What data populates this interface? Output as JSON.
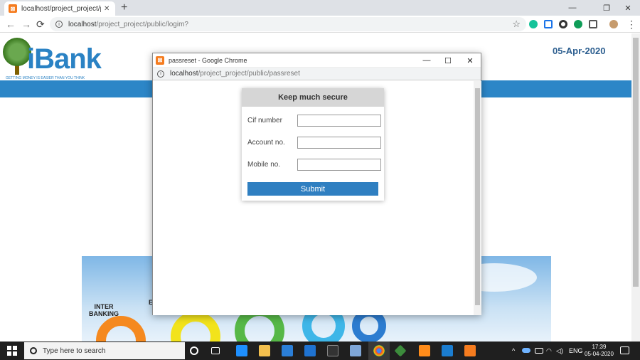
{
  "browser": {
    "tab_title": "localhost/project_project/public/",
    "tab_close": "✕",
    "new_tab": "+",
    "url_host": "localhost",
    "url_path": "/project_project/public/logim?",
    "window_controls": {
      "minimize": "—",
      "restore": "❐",
      "close": "✕"
    },
    "nav": {
      "back": "←",
      "forward": "→",
      "reload": "⟳"
    },
    "bookmark_icon": "☆",
    "menu_icon": "⋮"
  },
  "page": {
    "logo_text": "iBank",
    "logo_tagline": "GETTING MONEY IS EASIER THAN YOU THINK",
    "date": "05-Apr-2020",
    "banner_text_1": "INTER",
    "banner_text_2": "BANKING",
    "banner_text_3": "E"
  },
  "popup": {
    "window_title": "passreset - Google Chrome",
    "url_host": "localhost",
    "url_path": "/project_project/public/passreset",
    "controls": {
      "minimize": "—",
      "maximize": "☐",
      "close": "✕"
    },
    "form": {
      "title": "Keep much secure",
      "fields": [
        {
          "label": "Cif number",
          "value": ""
        },
        {
          "label": "Account no.",
          "value": ""
        },
        {
          "label": "Mobile no.",
          "value": ""
        }
      ],
      "submit_label": "Submit"
    }
  },
  "taskbar": {
    "search_placeholder": "Type here to search",
    "language": "ENG",
    "time": "17:39",
    "date": "05-04-2020"
  },
  "colors": {
    "brand_blue": "#2c86c7",
    "submit_blue": "#2f7fc1",
    "date_color": "#2c5e8f"
  }
}
